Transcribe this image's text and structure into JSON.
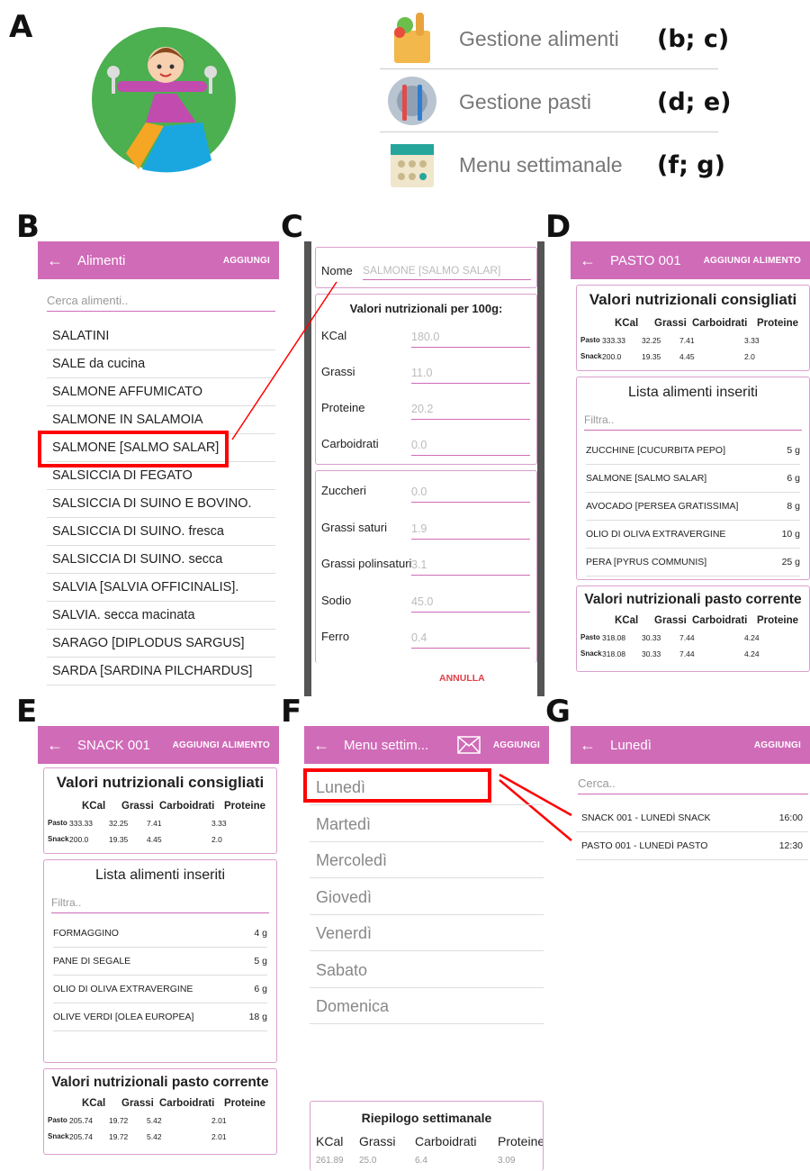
{
  "labels": {
    "a": "A",
    "b": "B",
    "c": "C",
    "d": "D",
    "e": "E",
    "f": "F",
    "g": "G"
  },
  "main_menu": [
    {
      "label": "Gestione alimenti",
      "tag": "(b; c)",
      "icon": "grocery-bag-icon"
    },
    {
      "label": "Gestione pasti",
      "tag": "(d; e)",
      "icon": "plate-cutlery-icon"
    },
    {
      "label": "Menu settimanale",
      "tag": "(f; g)",
      "icon": "calendar-icon"
    }
  ],
  "panel_b": {
    "title": "Alimenti",
    "action": "AGGIUNGI",
    "search_placeholder": "Cerca alimenti..",
    "items": [
      "SALATINI",
      "SALE da cucina",
      "SALMONE AFFUMICATO",
      "SALMONE IN SALAMOIA",
      "SALMONE [SALMO SALAR]",
      "SALSICCIA DI FEGATO",
      "SALSICCIA DI SUINO E BOVINO.",
      "SALSICCIA DI SUINO. fresca",
      "SALSICCIA DI SUINO. secca",
      "SALVIA [SALVIA OFFICINALIS].",
      "SALVIA. secca macinata",
      "SARAGO [DIPLODUS SARGUS]",
      "SARDA [SARDINA PILCHARDUS]"
    ]
  },
  "panel_c": {
    "name_label": "Nome",
    "name_value": "SALMONE [SALMO SALAR]",
    "nutrition_title": "Valori nutrizionali per 100g:",
    "main_fields": [
      {
        "label": "KCal",
        "value": "180.0"
      },
      {
        "label": "Grassi",
        "value": "11.0"
      },
      {
        "label": "Proteine",
        "value": "20.2"
      },
      {
        "label": "Carboidrati",
        "value": "0.0"
      }
    ],
    "extra_fields": [
      {
        "label": "Zuccheri",
        "value": "0.0"
      },
      {
        "label": "Grassi saturi",
        "value": "1.9"
      },
      {
        "label": "Grassi polinsaturi",
        "value": "3.1"
      },
      {
        "label": "Sodio",
        "value": "45.0"
      },
      {
        "label": "Ferro",
        "value": "0.4"
      }
    ],
    "cancel": "ANNULLA"
  },
  "panel_d": {
    "title": "PASTO 001",
    "action": "AGGIUNGI ALIMENTO",
    "recommended_title": "Valori nutrizionali consigliati",
    "headers": [
      "KCal",
      "Grassi",
      "Carboidrati",
      "Proteine"
    ],
    "recommended": [
      {
        "row": "Pasto",
        "vals": [
          "333.33",
          "32.25",
          "7.41",
          "3.33"
        ]
      },
      {
        "row": "Snack",
        "vals": [
          "200.0",
          "19.35",
          "4.45",
          "2.0"
        ]
      }
    ],
    "list_title": "Lista alimenti inseriti",
    "filter_placeholder": "Filtra..",
    "foods": [
      {
        "name": "ZUCCHINE [CUCURBITA PEPO]",
        "qty": "5 g"
      },
      {
        "name": "SALMONE [SALMO SALAR]",
        "qty": "6 g"
      },
      {
        "name": "AVOCADO [PERSEA GRATISSIMA]",
        "qty": "8 g"
      },
      {
        "name": "OLIO DI OLIVA EXTRAVERGINE",
        "qty": "10 g"
      },
      {
        "name": "PERA [PYRUS COMMUNIS]",
        "qty": "25 g"
      }
    ],
    "current_title": "Valori nutrizionali pasto corrente",
    "current": [
      {
        "row": "Pasto",
        "vals": [
          "318.08",
          "30.33",
          "7.44",
          "4.24"
        ]
      },
      {
        "row": "Snack",
        "vals": [
          "318.08",
          "30.33",
          "7.44",
          "4.24"
        ]
      }
    ]
  },
  "panel_e": {
    "title": "SNACK 001",
    "action": "AGGIUNGI ALIMENTO",
    "recommended_title": "Valori nutrizionali consigliati",
    "headers": [
      "KCal",
      "Grassi",
      "Carboidrati",
      "Proteine"
    ],
    "recommended": [
      {
        "row": "Pasto",
        "vals": [
          "333.33",
          "32.25",
          "7.41",
          "3.33"
        ]
      },
      {
        "row": "Snack",
        "vals": [
          "200.0",
          "19.35",
          "4.45",
          "2.0"
        ]
      }
    ],
    "list_title": "Lista alimenti inseriti",
    "filter_placeholder": "Filtra..",
    "foods": [
      {
        "name": "FORMAGGINO",
        "qty": "4 g"
      },
      {
        "name": "PANE DI SEGALE",
        "qty": "5 g"
      },
      {
        "name": "OLIO DI OLIVA EXTRAVERGINE",
        "qty": "6 g"
      },
      {
        "name": "OLIVE VERDI [OLEA EUROPEA]",
        "qty": "18 g"
      }
    ],
    "current_title": "Valori nutrizionali pasto corrente",
    "current": [
      {
        "row": "Pasto",
        "vals": [
          "205.74",
          "19.72",
          "5.42",
          "2.01"
        ]
      },
      {
        "row": "Snack",
        "vals": [
          "205.74",
          "19.72",
          "5.42",
          "2.01"
        ]
      }
    ]
  },
  "panel_f": {
    "title": "Menu settim...",
    "action": "AGGIUNGI",
    "days": [
      "Lunedì",
      "Martedì",
      "Mercoledì",
      "Giovedì",
      "Venerdì",
      "Sabato",
      "Domenica"
    ],
    "summary_title": "Riepilogo settimanale",
    "summary_headers": [
      "KCal",
      "Grassi",
      "Carboidrati",
      "Proteine"
    ],
    "summary_values": [
      "261.89",
      "25.0",
      "6.4",
      "3.09"
    ]
  },
  "panel_g": {
    "title": "Lunedì",
    "action": "AGGIUNGI",
    "search_placeholder": "Cerca..",
    "meals": [
      {
        "name": "SNACK 001 - LUNEDÌ SNACK",
        "time": "16:00"
      },
      {
        "name": "PASTO 001 - LUNEDÌ PASTO",
        "time": "12:30"
      }
    ]
  },
  "colors": {
    "accent": "#d06bb8",
    "highlight": "#ff0000"
  }
}
